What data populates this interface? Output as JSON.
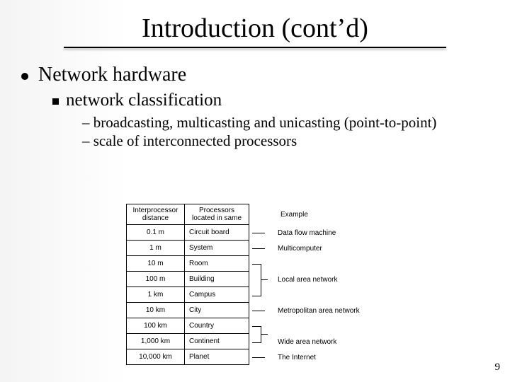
{
  "title": "Introduction (cont’d)",
  "lvl1": "Network hardware",
  "lvl2": "network classification",
  "lvl3a": "– broadcasting, multicasting and unicasting (point-to-point)",
  "lvl3b": "– scale of interconnected processors",
  "page_num": "9",
  "fig": {
    "headers": {
      "dist": "Interprocessor distance",
      "loc": "Processors located in same",
      "ex": "Example"
    },
    "rows": [
      {
        "dist": "0.1 m",
        "loc": "Circuit board",
        "ex": "Data flow machine"
      },
      {
        "dist": "1 m",
        "loc": "System",
        "ex": "Multicomputer"
      },
      {
        "dist": "10 m",
        "loc": "Room",
        "ex": ""
      },
      {
        "dist": "100 m",
        "loc": "Building",
        "ex": "Local area network"
      },
      {
        "dist": "1 km",
        "loc": "Campus",
        "ex": ""
      },
      {
        "dist": "10 km",
        "loc": "City",
        "ex": "Metropolitan area network"
      },
      {
        "dist": "100 km",
        "loc": "Country",
        "ex": ""
      },
      {
        "dist": "1,000 km",
        "loc": "Continent",
        "ex": "Wide area network"
      },
      {
        "dist": "10,000 km",
        "loc": "Planet",
        "ex": "The Internet"
      }
    ]
  }
}
